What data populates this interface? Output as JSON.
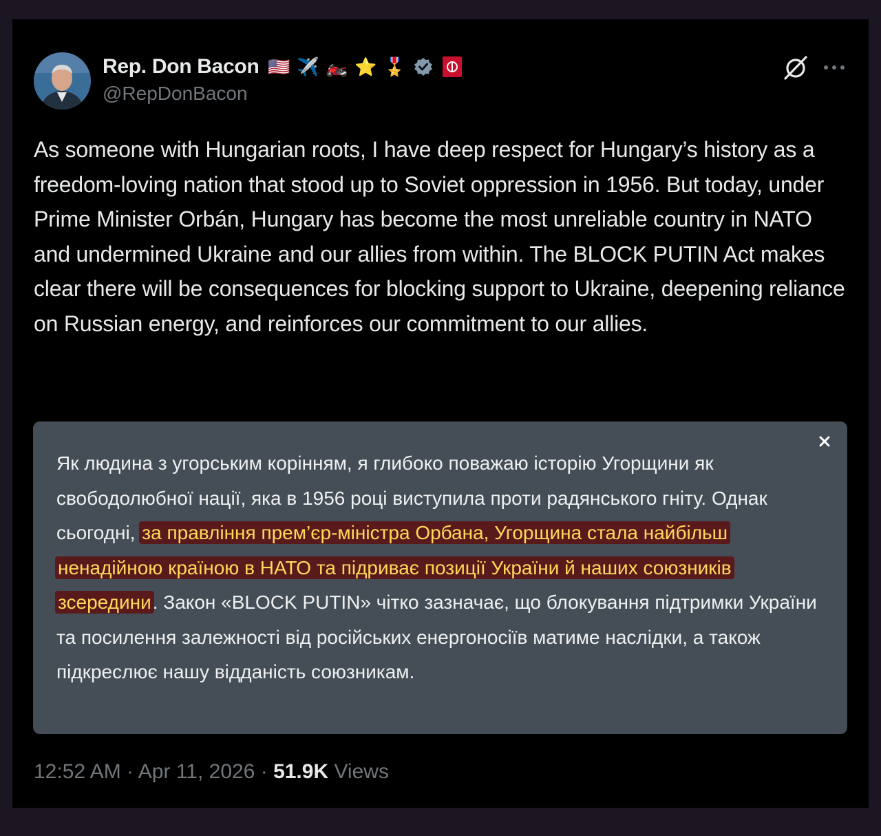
{
  "author": {
    "display_name": "Rep. Don Bacon",
    "handle": "@RepDonBacon",
    "badges": [
      "us-flag",
      "airplane",
      "motorcycle",
      "star",
      "military-medal",
      "verified-badge",
      "red-tag"
    ]
  },
  "tweet": {
    "text": "As someone with Hungarian roots, I have deep respect for Hungary’s history as a freedom-loving nation that stood up to Soviet oppression in 1956. But today, under Prime Minister Orbán, Hungary has become the most unreliable country in NATO and undermined Ukraine and our allies from within. The BLOCK PUTIN Act makes clear there will be consequences for blocking support to Ukraine, deepening reliance on Russian energy, and reinforces our commitment to our allies."
  },
  "translation": {
    "before": "Як людина з угорським корінням, я глибоко поважаю історію Угорщини як свободолюбної нації, яка в 1956 році виступила проти радянського гніту. Однак сьогодні, ",
    "highlight": "за правління прем’єр-міністра Орбана, Угорщина стала найбільш ненадійною країною в НАТО та підриває позиції України й наших союзників зсередини",
    "after": ". Закон «BLOCK PUTIN» чітко зазначає, що блокування підтримки України та посилення залежності від російських енергоносіїв матиме наслідки, а також підкреслює нашу відданість союзникам.",
    "highlight_color": "#5a1a1c",
    "highlight_text_color": "#ffd95a"
  },
  "meta": {
    "time": "12:52 AM",
    "separator": "·",
    "date": "Apr 11, 2026",
    "views_count": "51.9K",
    "views_label": "Views"
  },
  "icons": {
    "grok": "grok-icon",
    "more": "more-icon",
    "close": "close-icon"
  }
}
